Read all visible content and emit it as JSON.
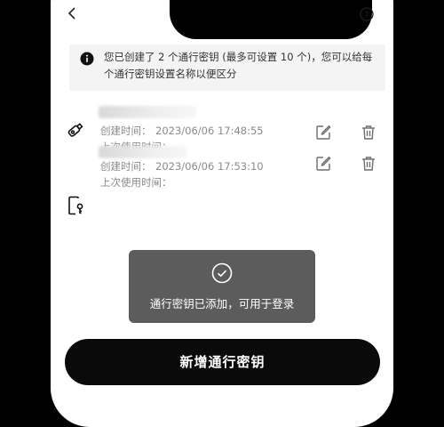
{
  "info_banner": {
    "icon": "info-icon",
    "line1": "您已创建了 2 个通行密钥 (最多可设置 10 个)，您可以给每",
    "line2": "个通行密钥设置名称以便区分"
  },
  "passkeys": [
    {
      "icon": "usb-key-icon",
      "created_label": "创建时间：",
      "created_value": "2023/06/06 17:48:55",
      "last_used_label": "上次使用时间：",
      "last_used_value": "-"
    },
    {
      "icon": "device-key-icon",
      "created_label": "创建时间：",
      "created_value": "2023/06/06 17:53:10",
      "last_used_label": "上次使用时间：",
      "last_used_value": "-"
    }
  ],
  "toast": {
    "icon": "check-circle-icon",
    "message": "通行密钥已添加，可用于登录"
  },
  "footer": {
    "add_button_label": "新增通行密钥"
  },
  "colors": {
    "background": "#000000",
    "primary_button": "#0a0a0a",
    "banner": "#f4f4f4",
    "toast": "#505050",
    "secondary_text": "#8a8a8a"
  }
}
